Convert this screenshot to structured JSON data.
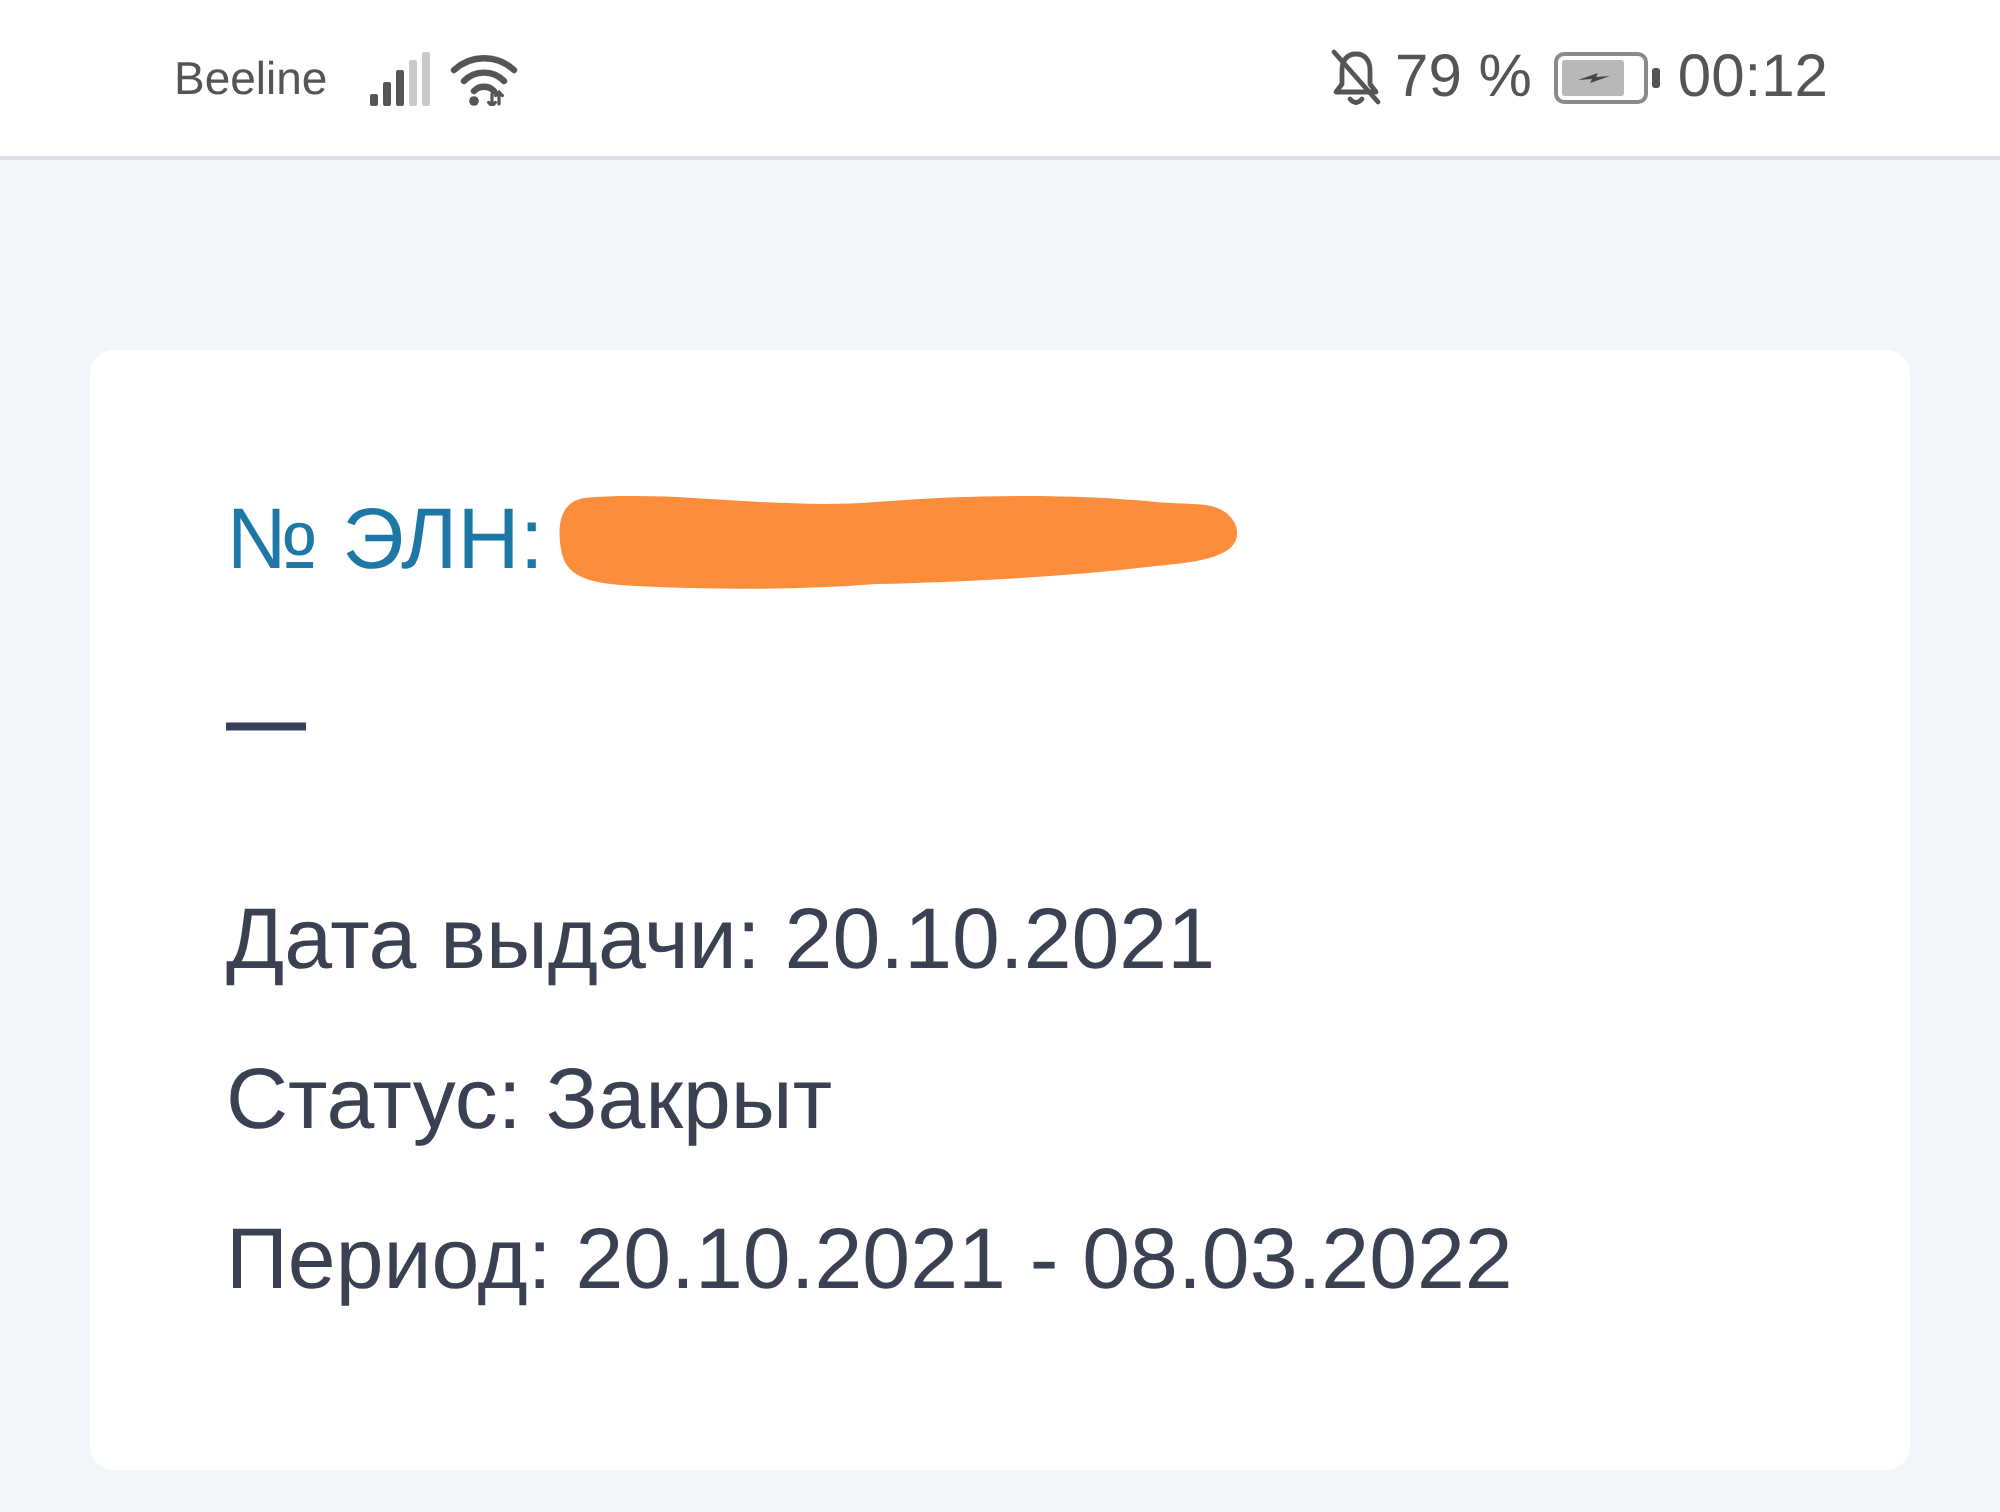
{
  "status_bar": {
    "carrier": "Beeline",
    "notifications_muted": true,
    "battery_percent": "79 %",
    "time": "00:12"
  },
  "card": {
    "title": "№ ЭЛН:",
    "number_redacted": true,
    "subtitle": "—",
    "details": [
      "Дата выдачи: 20.10.2021",
      "Статус: Закрыт",
      "Период: 20.10.2021 - 08.03.2022"
    ]
  }
}
